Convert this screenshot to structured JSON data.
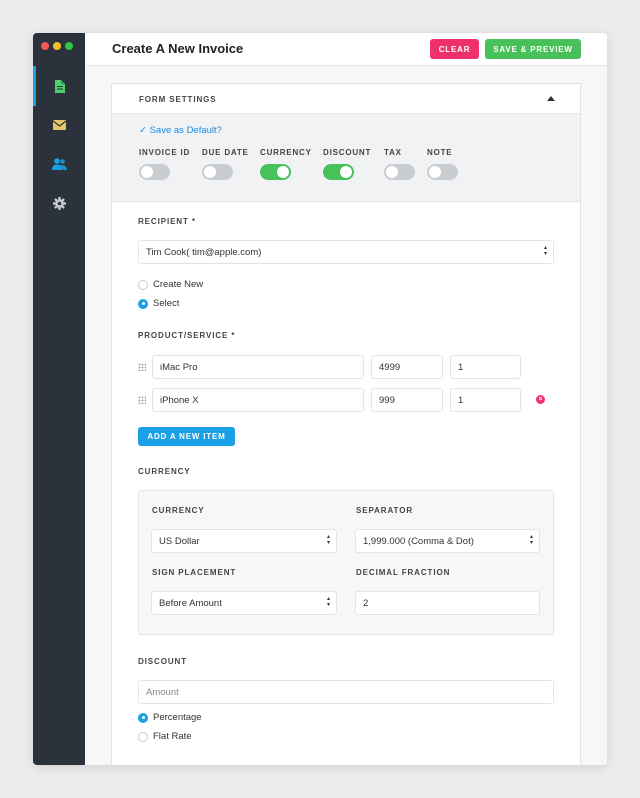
{
  "window": {
    "traffic_colors": [
      "#ee5a52",
      "#f5be30",
      "#2fc840"
    ]
  },
  "sidebar": {
    "items": [
      {
        "icon": "document-icon",
        "color": "#4cd06a",
        "active": true
      },
      {
        "icon": "inbox-icon",
        "color": "#e8c56a",
        "active": false
      },
      {
        "icon": "users-icon",
        "color": "#1aa0e6",
        "active": false
      },
      {
        "icon": "gear-icon",
        "color": "#c7ccd2",
        "active": false
      }
    ]
  },
  "header": {
    "title": "Create A New Invoice",
    "clear_label": "CLEAR",
    "save_label": "SAVE & PREVIEW"
  },
  "form_settings": {
    "title": "FORM SETTINGS",
    "save_default": "✓ Save as Default?",
    "toggles": [
      {
        "label": "INVOICE ID",
        "on": false
      },
      {
        "label": "DUE DATE",
        "on": false
      },
      {
        "label": "CURRENCY",
        "on": true
      },
      {
        "label": "DISCOUNT",
        "on": true
      },
      {
        "label": "TAX",
        "on": false
      },
      {
        "label": "NOTE",
        "on": false
      }
    ]
  },
  "recipient": {
    "label": "RECIPIENT *",
    "value": "Tim Cook( tim@apple.com)",
    "options": [
      {
        "label": "Create New",
        "selected": false
      },
      {
        "label": "Select",
        "selected": true
      }
    ]
  },
  "products": {
    "label": "PRODUCT/SERVICE *",
    "rows": [
      {
        "name": "iMac Pro",
        "price": "4999",
        "qty": "1",
        "removable": false
      },
      {
        "name": "iPhone X",
        "price": "999",
        "qty": "1",
        "removable": true
      }
    ],
    "add_label": "ADD A NEW ITEM"
  },
  "currency": {
    "section_label": "CURRENCY",
    "currency_label": "CURRENCY",
    "currency_value": "US Dollar",
    "separator_label": "SEPARATOR",
    "separator_value": "1,999.000 (Comma & Dot)",
    "sign_label": "SIGN PLACEMENT",
    "sign_value": "Before Amount",
    "decimal_label": "DECIMAL FRACTION",
    "decimal_value": "2"
  },
  "discount": {
    "label": "DISCOUNT",
    "placeholder": "Amount",
    "options": [
      {
        "label": "Percentage",
        "selected": true
      },
      {
        "label": "Flat Rate",
        "selected": false
      }
    ]
  }
}
